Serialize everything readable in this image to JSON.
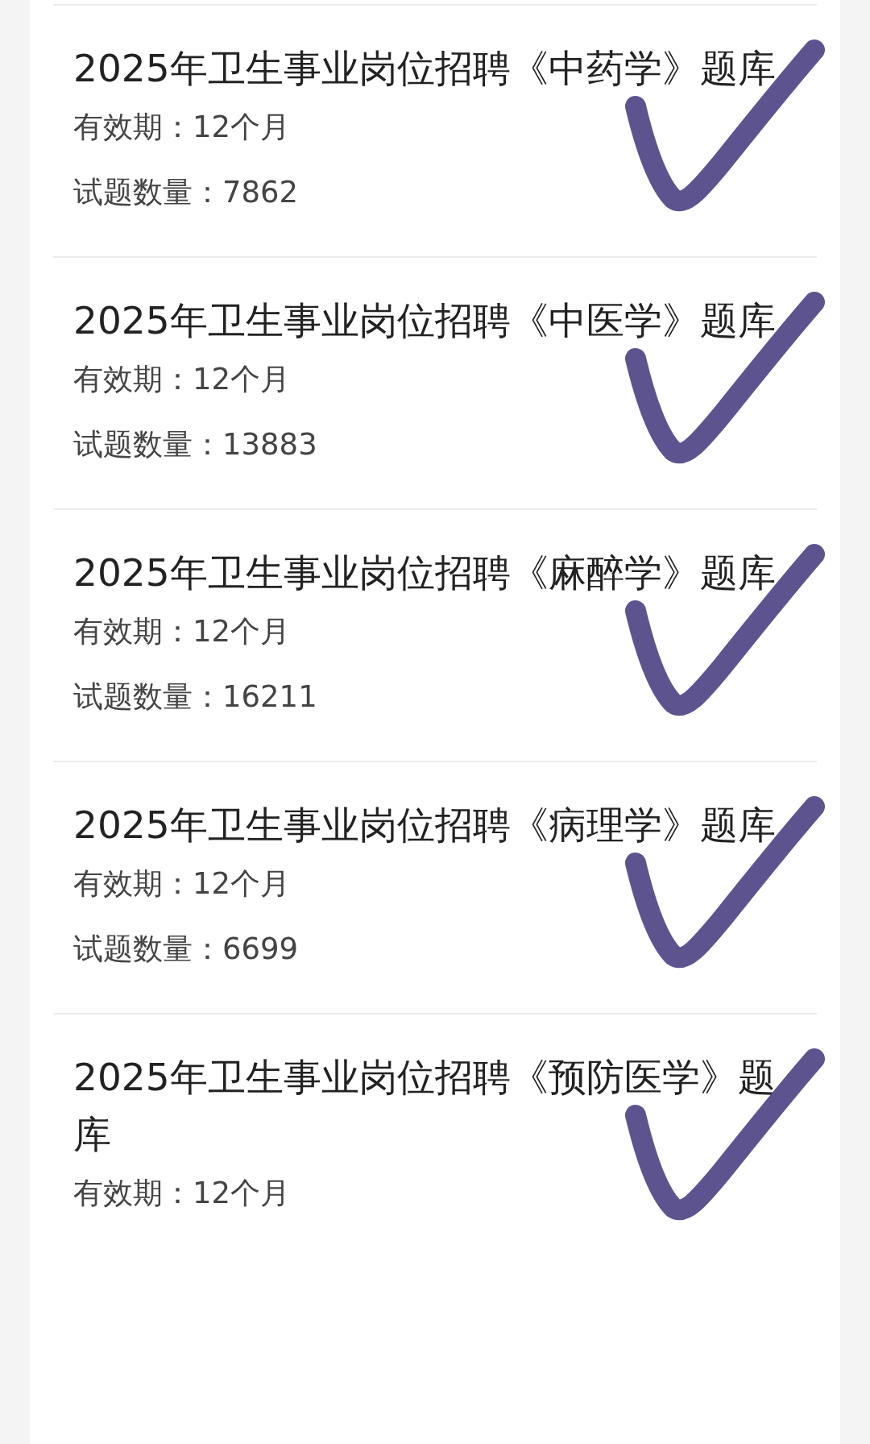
{
  "items": [
    {
      "title": "2025年卫生事业岗位招聘《中药学》题库",
      "validity": "有效期：12个月",
      "question_count": "试题数量：7862",
      "checked": true
    },
    {
      "title": "2025年卫生事业岗位招聘《中医学》题库",
      "validity": "有效期：12个月",
      "question_count": "试题数量：13883",
      "checked": true
    },
    {
      "title": "2025年卫生事业岗位招聘《麻醉学》题库",
      "validity": "有效期：12个月",
      "question_count": "试题数量：16211",
      "checked": true
    },
    {
      "title": "2025年卫生事业岗位招聘《病理学》题库",
      "validity": "有效期：12个月",
      "question_count": "试题数量：6699",
      "checked": true
    },
    {
      "title": "2025年卫生事业岗位招聘《预防医学》题库",
      "validity": "有效期：12个月",
      "checked": true
    }
  ]
}
